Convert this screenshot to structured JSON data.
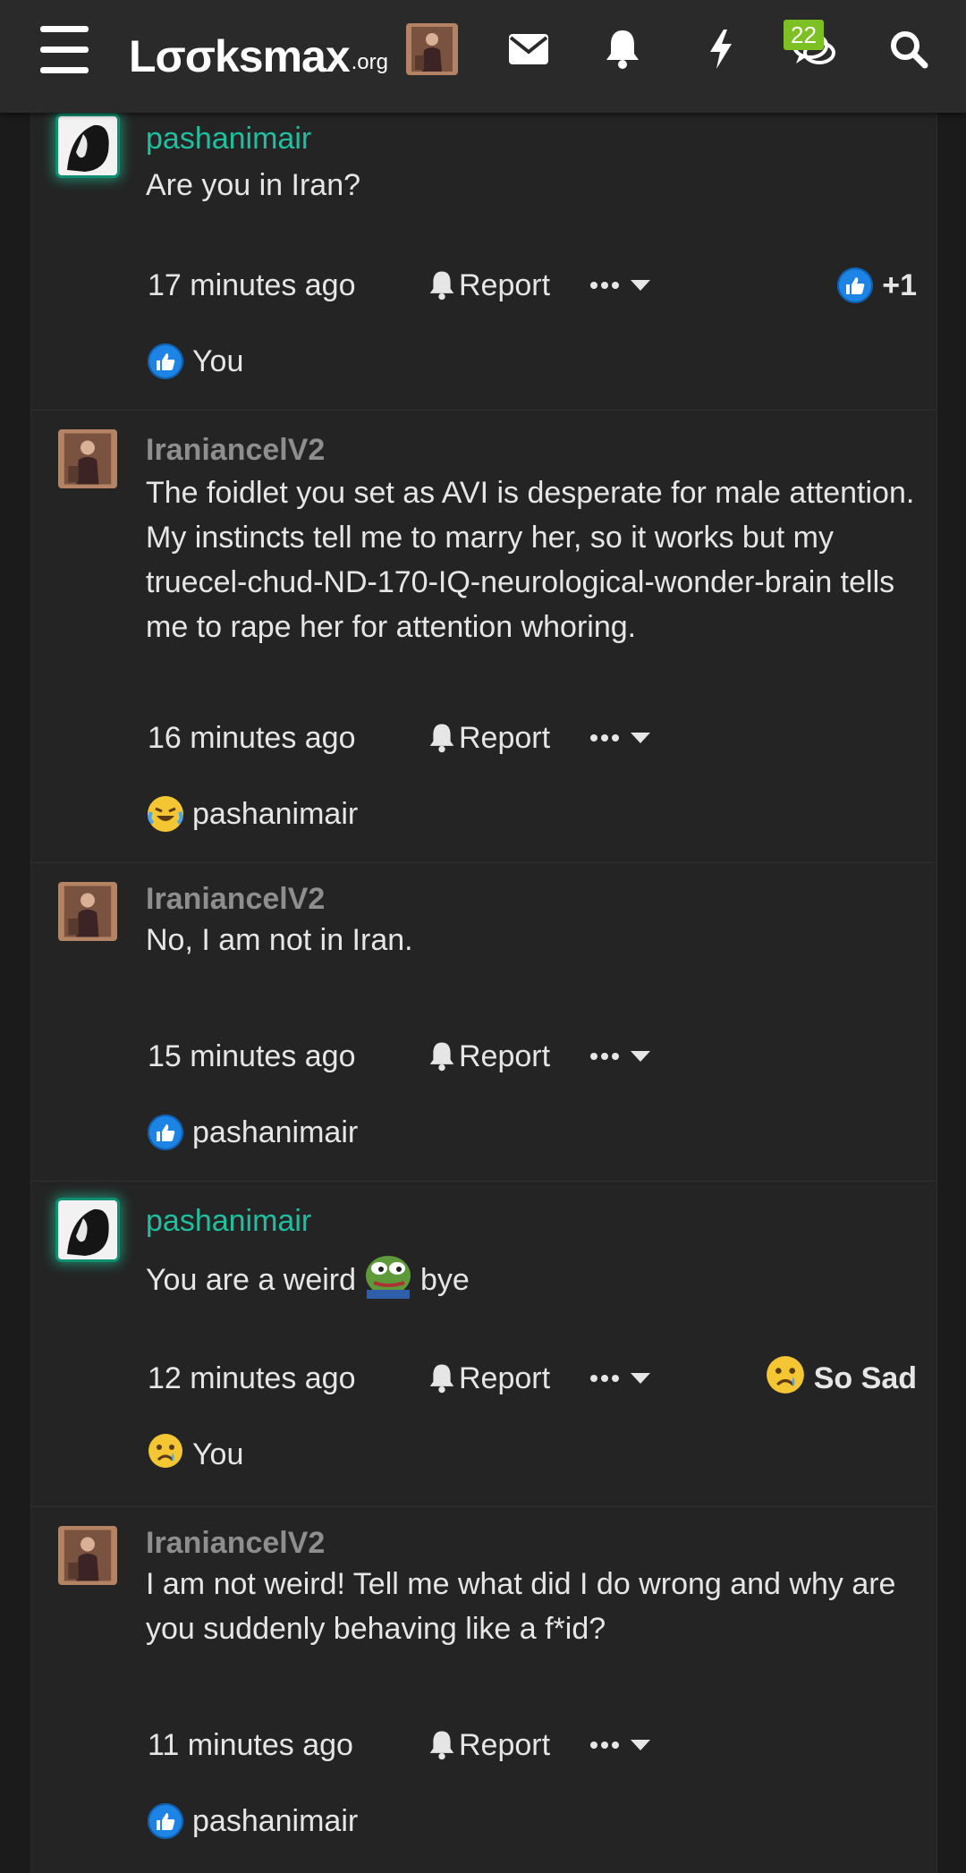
{
  "header": {
    "logo_main": "Lσσksmax",
    "logo_ext": ".org",
    "conversations_count": "22",
    "icons": [
      "menu-icon",
      "envelope-icon",
      "bell-icon",
      "bolt-icon",
      "chat-bubbles-icon",
      "search-icon"
    ]
  },
  "colors": {
    "teal_username": "#1fbf9f",
    "grey_username": "#8e8e8e",
    "like_blue": "#1d84e5",
    "badge_green": "#7cc024"
  },
  "posts": [
    {
      "username": "pashanimair",
      "text": "Are you in Iran?",
      "time": "17 minutes ago",
      "report": "Report",
      "reaction_summary": "+1",
      "reaction_by": "You"
    },
    {
      "username": "IraniancelV2",
      "text": "The foidlet you set as AVI is desperate for male attention. My instincts tell me to marry her, so it works but my truecel-chud-ND-170-IQ-neurological-wonder-brain tells me to rape her for attention whoring.",
      "time": "16 minutes ago",
      "report": "Report",
      "reaction_by": "pashanimair"
    },
    {
      "username": "IraniancelV2",
      "text": "No, I am not in Iran.",
      "time": "15 minutes ago",
      "report": "Report",
      "reaction_by": "pashanimair"
    },
    {
      "username": "pashanimair",
      "text_before": "You are a weird",
      "text_after": "bye",
      "time": "12 minutes ago",
      "report": "Report",
      "reaction_summary": "So Sad",
      "reaction_by": "You"
    },
    {
      "username": "IraniancelV2",
      "text": "I am not weird! Tell me what did I do wrong and why are you suddenly behaving like a f*id?",
      "time": "11 minutes ago",
      "report": "Report",
      "reaction_by": "pashanimair"
    }
  ]
}
